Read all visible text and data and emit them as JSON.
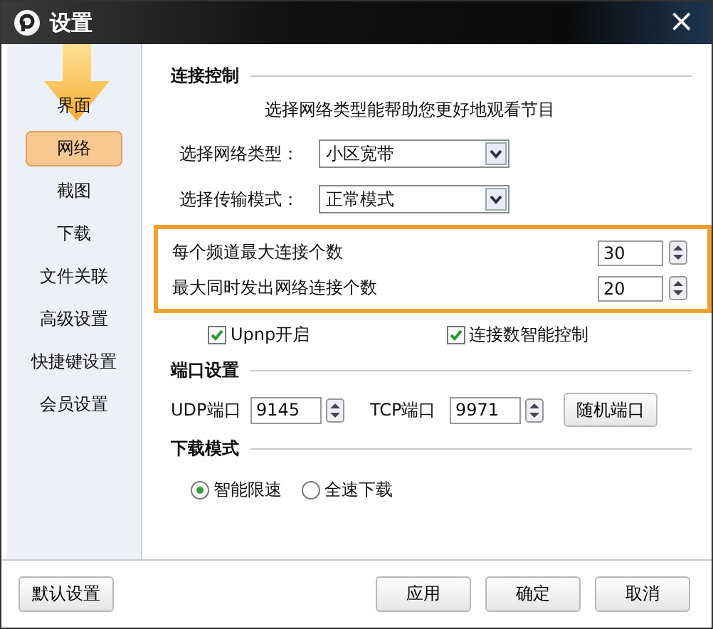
{
  "window": {
    "title": "设置",
    "close": "×"
  },
  "sidebar": {
    "items": [
      {
        "label": "界面",
        "selected": false
      },
      {
        "label": "网络",
        "selected": true
      },
      {
        "label": "截图",
        "selected": false
      },
      {
        "label": "下载",
        "selected": false
      },
      {
        "label": "文件关联",
        "selected": false
      },
      {
        "label": "高级设置",
        "selected": false
      },
      {
        "label": "快捷键设置",
        "selected": false
      },
      {
        "label": "会员设置",
        "selected": false
      }
    ]
  },
  "connection": {
    "heading": "连接控制",
    "hint": "选择网络类型能帮助您更好地观看节目",
    "selects": [
      {
        "label": "选择网络类型：",
        "value": "小区宽带"
      },
      {
        "label": "选择传输模式：",
        "value": "正常模式"
      }
    ],
    "spinners": [
      {
        "label": "每个频道最大连接个数",
        "value": "30"
      },
      {
        "label": "最大同时发出网络连接个数",
        "value": "20"
      }
    ],
    "checkboxes": [
      {
        "label": "Upnp开启",
        "checked": true
      },
      {
        "label": "连接数智能控制",
        "checked": true
      }
    ]
  },
  "ports": {
    "heading": "端口设置",
    "fields": [
      {
        "label": "UDP端口",
        "value": "9145"
      },
      {
        "label": "TCP端口",
        "value": "9971"
      }
    ],
    "button": "随机端口"
  },
  "download_mode": {
    "heading": "下载模式",
    "options": [
      {
        "label": "智能限速",
        "selected": true
      },
      {
        "label": "全速下载",
        "selected": false
      }
    ]
  },
  "footer": {
    "left_button": "默认设置",
    "buttons": [
      "应用",
      "确定",
      "取消"
    ]
  }
}
